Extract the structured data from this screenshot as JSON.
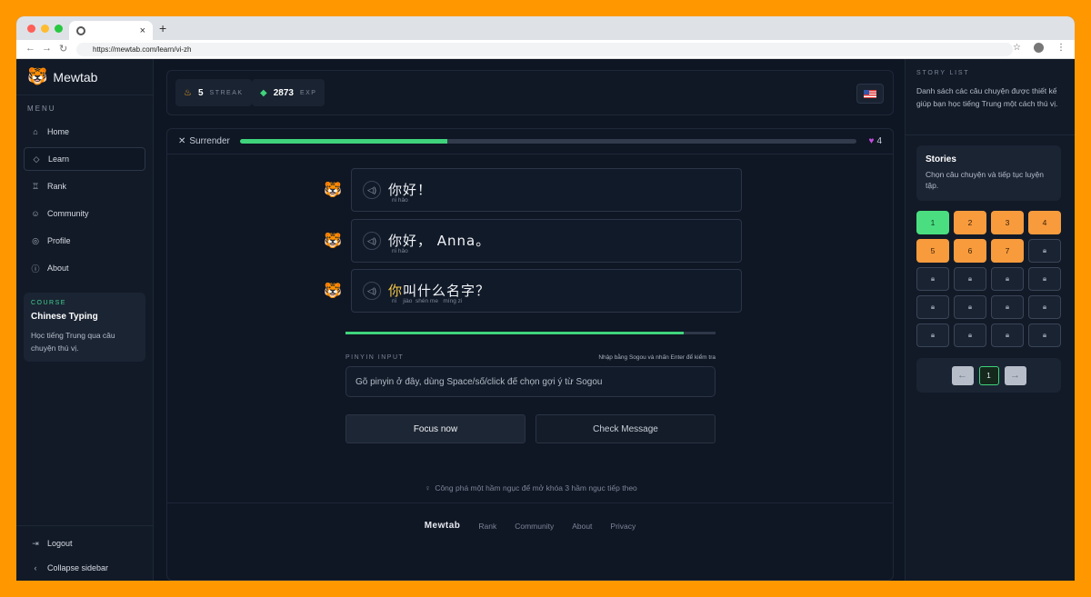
{
  "browser": {
    "url": "https://mewtab.com/learn/vi-zh",
    "tab_close": "×",
    "new_tab": "+"
  },
  "sidebar": {
    "brand": "Mewtab",
    "brand_icon": "🐯",
    "menu_label": "MENU",
    "items": [
      {
        "label": "Home",
        "icon": "home-icon",
        "glyph": "⌂"
      },
      {
        "label": "Learn",
        "icon": "book-icon",
        "glyph": "◇"
      },
      {
        "label": "Rank",
        "icon": "trophy-icon",
        "glyph": "♖"
      },
      {
        "label": "Community",
        "icon": "users-icon",
        "glyph": "☺"
      },
      {
        "label": "Profile",
        "icon": "user-icon",
        "glyph": "◎"
      },
      {
        "label": "About",
        "icon": "info-icon",
        "glyph": "ⓘ"
      }
    ],
    "course": {
      "tag": "COURSE",
      "title": "Chinese Typing",
      "desc": "Học tiếng Trung qua câu chuyện thú vị."
    },
    "logout": "Logout",
    "collapse": "Collapse sidebar"
  },
  "topbar": {
    "streak_value": "5",
    "streak_label": "STREAK",
    "exp_value": "2873",
    "exp_label": "EXP"
  },
  "lesson": {
    "surrender": "Surrender",
    "progress": 0.336,
    "hearts": "4",
    "messages": [
      {
        "hanzi": "你好！",
        "pinyin": "nǐ hǎo"
      },
      {
        "hanzi": "你好， Anna。",
        "pinyin": "nǐ hǎo"
      },
      {
        "hanzi_hl": "你",
        "hanzi_rest": "叫什么名字？",
        "pinyin": "nǐ    jiào  shén me   míng zi"
      }
    ],
    "answer_progress": 0.915,
    "input_label": "PINYIN INPUT",
    "input_hint": "Nhập bằng Sogou và nhấn Enter để kiểm tra",
    "input_placeholder": "Gõ pinyin ở đây, dùng Space/số/click để chọn gợi ý từ Sogou",
    "focus_button": "Focus now",
    "check_button": "Check Message",
    "tip": "Công phá một hầm ngục để mở khóa 3 hầm ngục tiếp theo"
  },
  "footer": {
    "brand": "Mewtab",
    "links": [
      "Rank",
      "Community",
      "About",
      "Privacy"
    ]
  },
  "right_panel": {
    "label": "STORY LIST",
    "desc": "Danh sách các câu chuyện được thiết kế giúp bạn học tiếng Trung một cách thú vị.",
    "stories_title": "Stories",
    "stories_desc": "Chọn câu chuyện và tiếp tục luyện tập.",
    "cells": [
      {
        "label": "1",
        "state": "done"
      },
      {
        "label": "2",
        "state": "open"
      },
      {
        "label": "3",
        "state": "open"
      },
      {
        "label": "4",
        "state": "open"
      },
      {
        "label": "5",
        "state": "open"
      },
      {
        "label": "6",
        "state": "open"
      },
      {
        "label": "7",
        "state": "open"
      }
    ],
    "locked_count": 13,
    "page": "1"
  }
}
